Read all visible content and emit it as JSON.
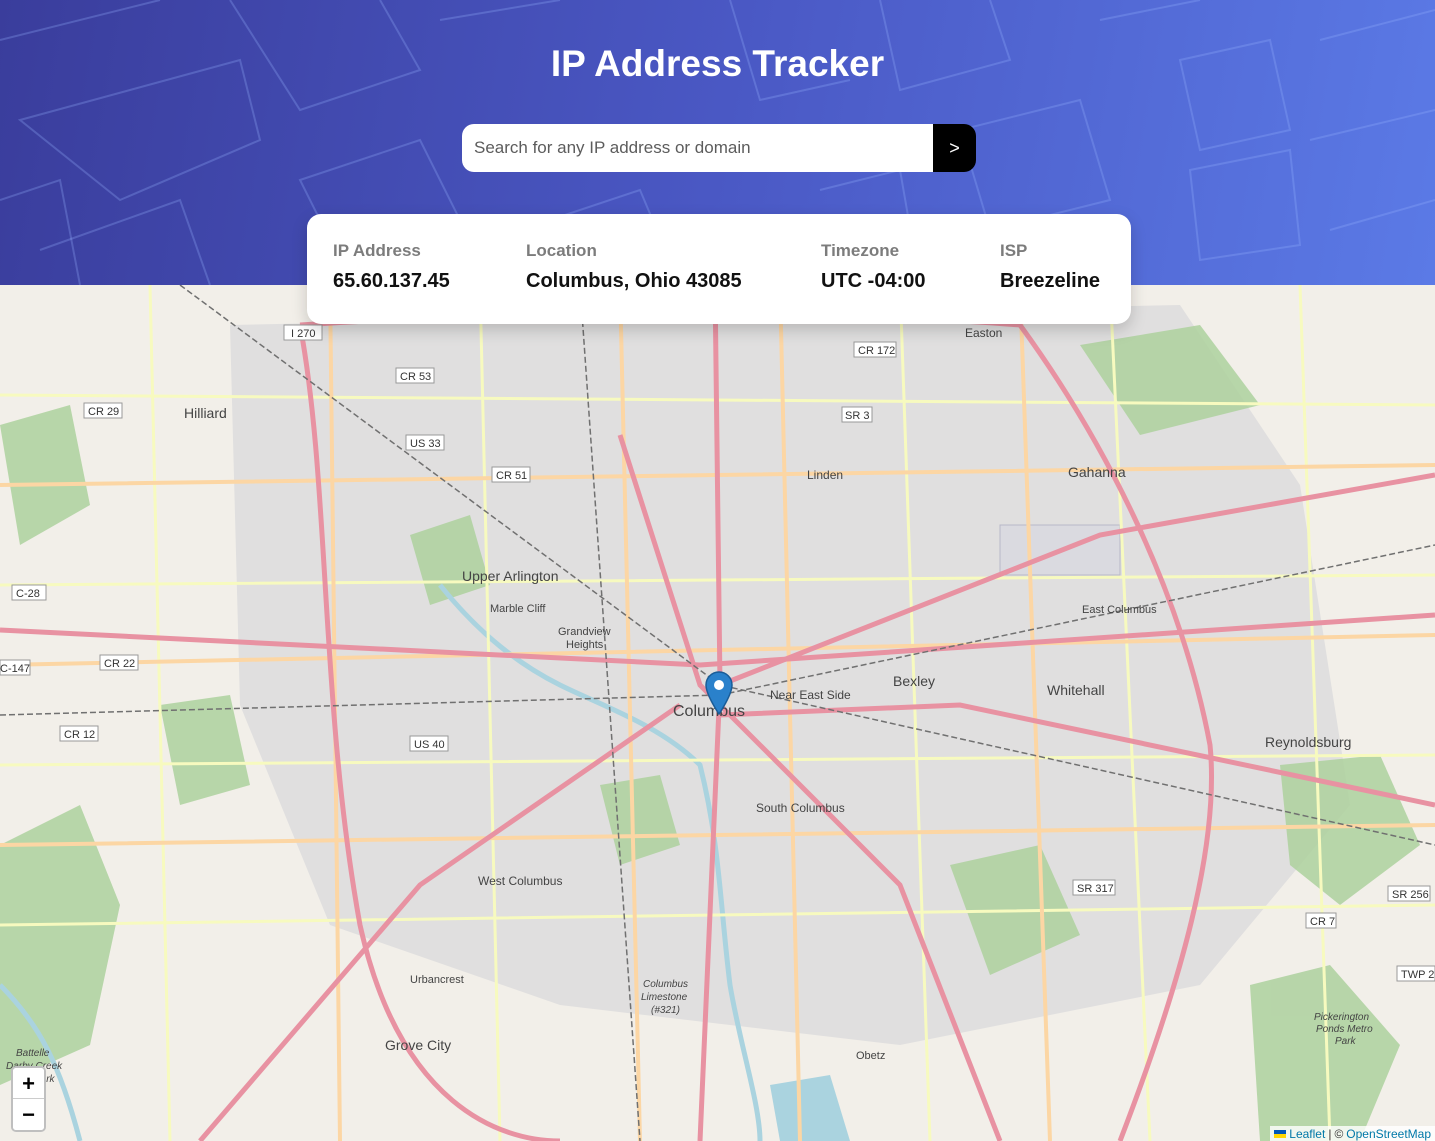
{
  "app": {
    "title": "IP Address Tracker"
  },
  "search": {
    "placeholder": "Search for any IP address or domain",
    "value": "",
    "button_label": ">"
  },
  "info": {
    "ip": {
      "label": "IP Address",
      "value": "65.60.137.45"
    },
    "location": {
      "label": "Location",
      "value": "Columbus, Ohio 43085"
    },
    "timezone": {
      "label": "Timezone",
      "value": "UTC -04:00"
    },
    "isp": {
      "label": "ISP",
      "value": "Breezeline"
    }
  },
  "map": {
    "zoom_in_label": "+",
    "zoom_out_label": "−",
    "attribution": {
      "leaflet": "Leaflet",
      "separator": "|",
      "copyright": "©",
      "osm": "OpenStreetMap"
    },
    "marker_icon": "map-pin-icon",
    "places": [
      "Hilliard",
      "Upper Arlington",
      "Marble Cliff",
      "Grandview Heights",
      "Columbus",
      "Near East Side",
      "Bexley",
      "Whitehall",
      "Reynoldsburg",
      "Gahanna",
      "East Columbus",
      "Linden",
      "Easton",
      "South Columbus",
      "West Columbus",
      "Urbancrest",
      "Grove City",
      "Obetz",
      "Columbus Limestone (#321)",
      "Pickerington Ponds Metro Park",
      "Battelle Darby Creek Park"
    ],
    "road_shields": [
      "I 270",
      "CR 53",
      "US 33",
      "CR 51",
      "CR 29",
      "C-28",
      "CR 22",
      "CR 12",
      "C-147",
      "US 40",
      "CR 172",
      "SR 3",
      "SR 317",
      "SR 256",
      "CR 7",
      "TWP 2"
    ],
    "colors": {
      "land": "#f2efe9",
      "urban": "#e0dfdf",
      "park": "#add19e",
      "motorway": "#e892a2",
      "primary": "#fcd6a4",
      "secondary": "#f7fabf",
      "water": "#aad3df",
      "marker": "#2a81cb"
    }
  },
  "theme": {
    "header_gradient": [
      "#3a3d9c",
      "#5b7ae6"
    ],
    "card_bg": "#ffffff",
    "button_bg": "#000000"
  }
}
